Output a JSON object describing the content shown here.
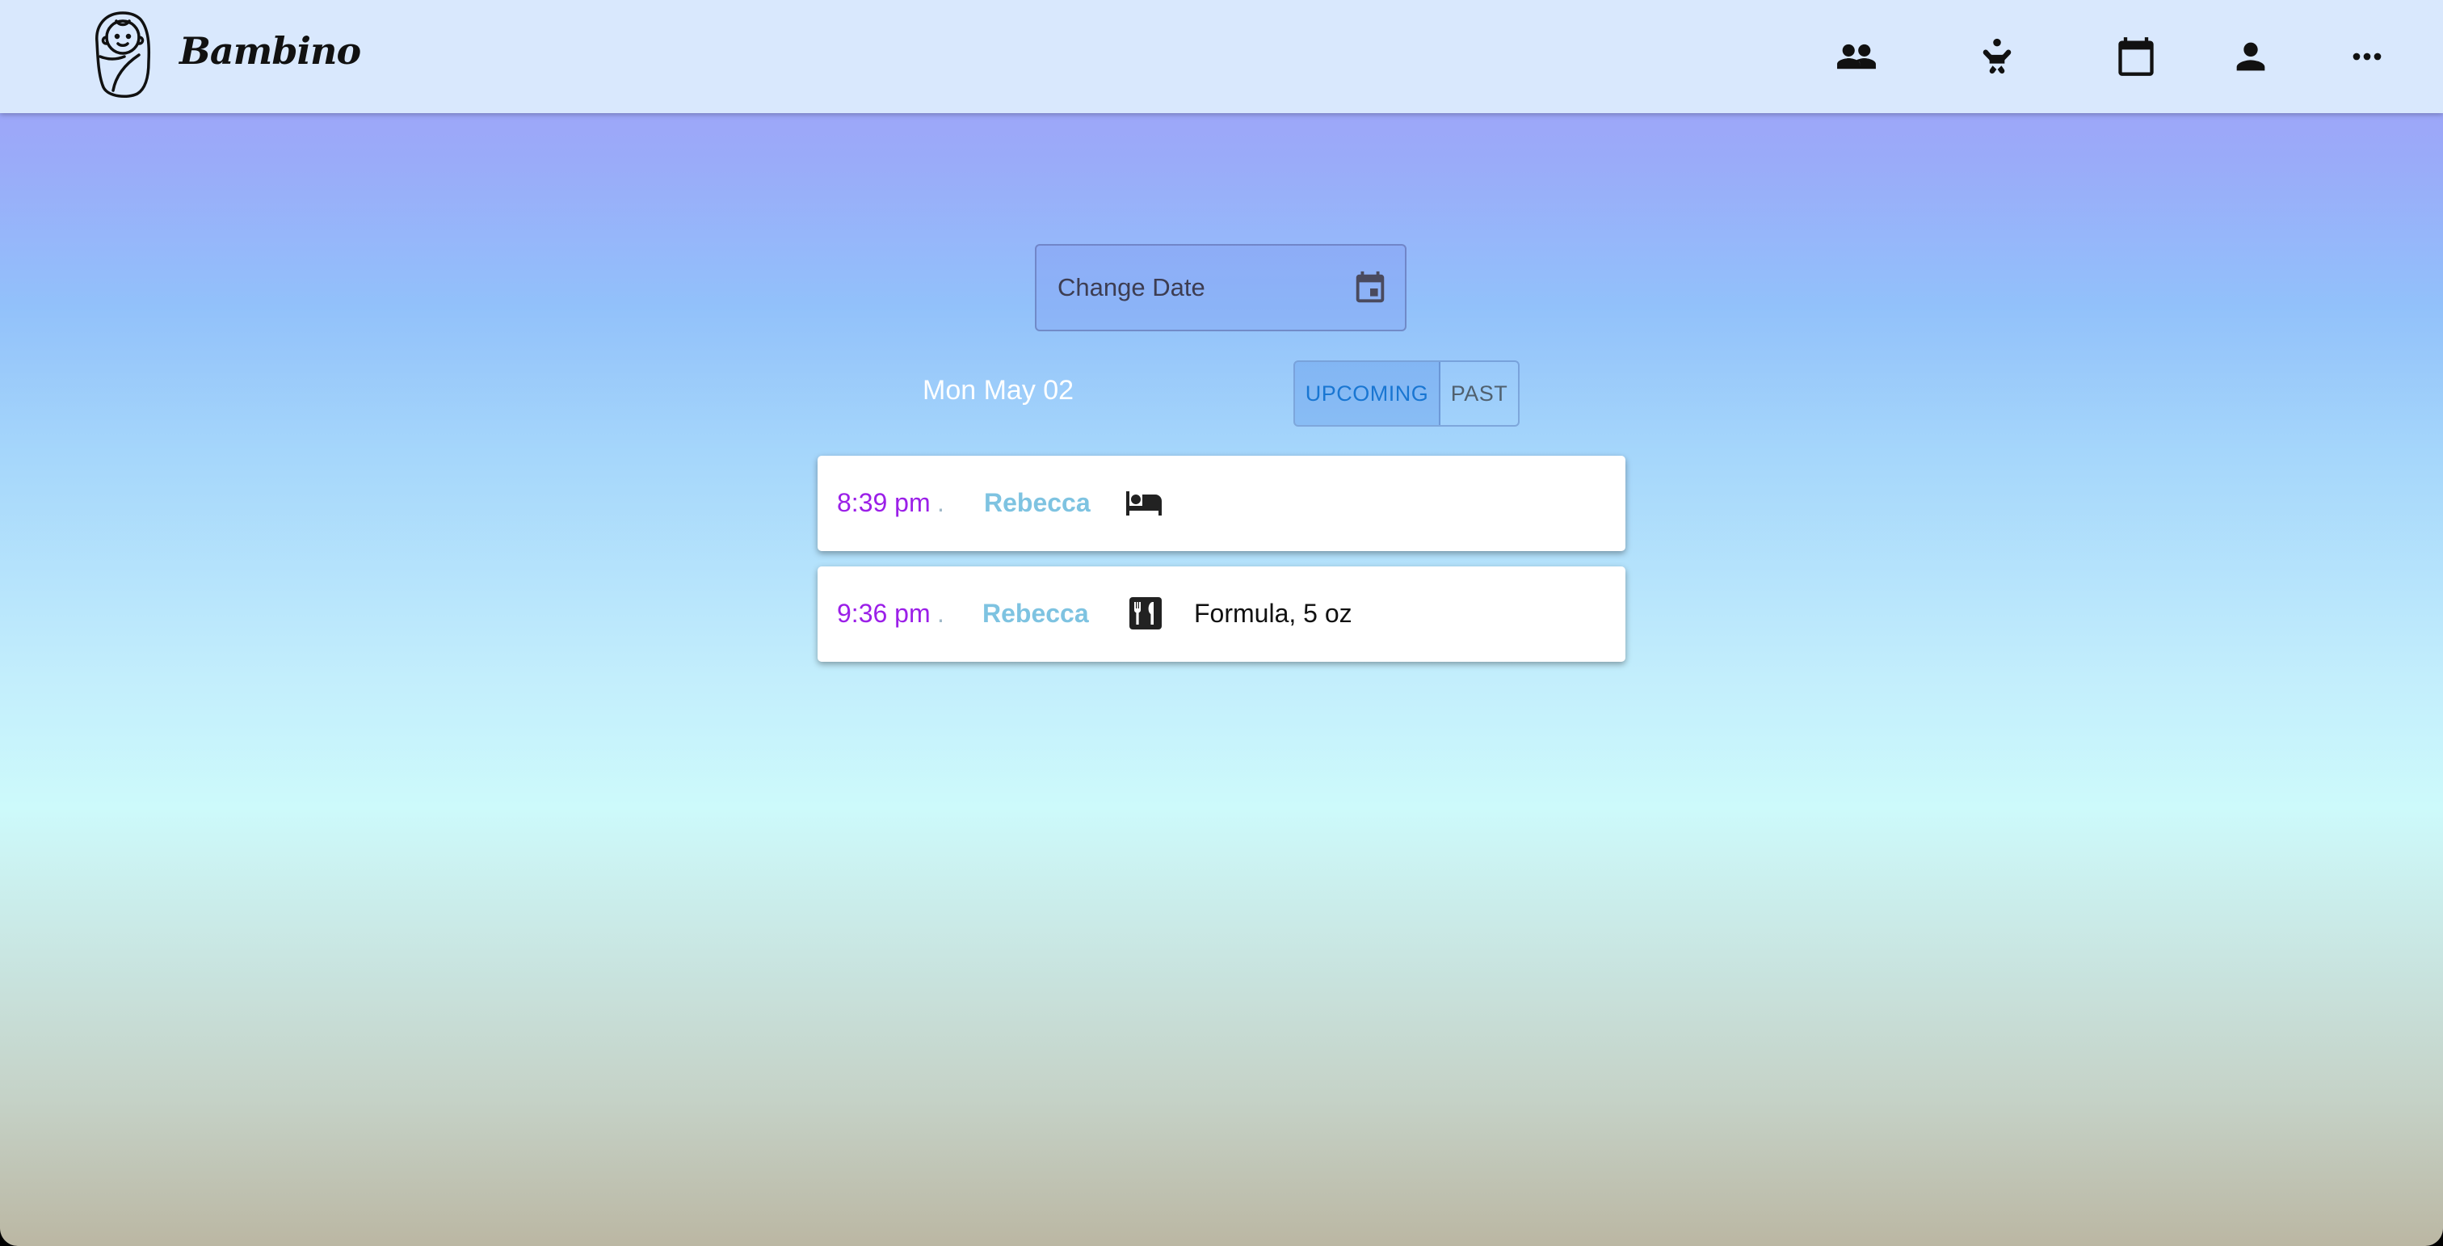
{
  "app": {
    "brand": "Bambino",
    "logo_icon": "swaddled-baby-logo-icon"
  },
  "nav": [
    {
      "name": "people-icon"
    },
    {
      "name": "baby-icon"
    },
    {
      "name": "calendar-icon"
    },
    {
      "name": "person-icon"
    },
    {
      "name": "more-horiz-icon"
    }
  ],
  "date_picker": {
    "label": "Change Date",
    "icon": "calendar-event-icon"
  },
  "current_date": "Mon May 02",
  "filter": {
    "upcoming_label": "UPCOMING",
    "past_label": "PAST",
    "selected": "UPCOMING"
  },
  "events": [
    {
      "time": "8:39 pm",
      "dot": ".",
      "baby": "Rebecca",
      "icon": "bed-icon",
      "detail": ""
    },
    {
      "time": "9:36 pm",
      "dot": ".",
      "baby": "Rebecca",
      "icon": "restaurant-icon",
      "detail": "Formula, 5 oz"
    }
  ],
  "colors": {
    "app_bar": "#d9e8fd",
    "time": "#9b1fe8",
    "baby_name": "#7ec3e1",
    "selected_toggle": "#1976d2"
  }
}
